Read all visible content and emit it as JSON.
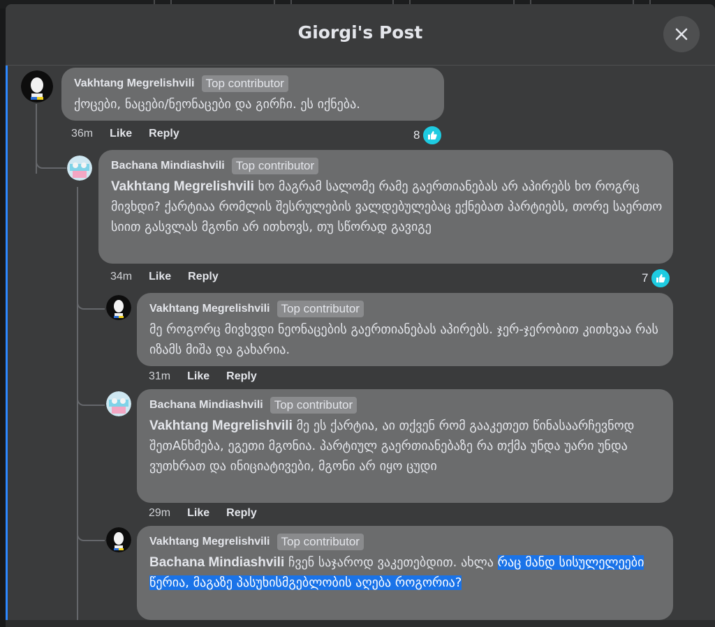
{
  "modal": {
    "title": "Giorgi's Post"
  },
  "badge_label": "Top contributor",
  "actions": {
    "like": "Like",
    "reply": "Reply"
  },
  "colors": {
    "accent": "#2d88ff",
    "like": "#1ecbe1",
    "highlight": "#1a73e8"
  },
  "comments": [
    {
      "author": "Vakhtang Megrelishvili",
      "text": "ქოცები, ნაცები/ნეონაცები და გირჩი. ეს იქნება.",
      "time": "36m",
      "reactions": "8"
    },
    {
      "author": "Bachana Mindiashvili",
      "mention": "Vakhtang Megrelishvili",
      "text": " ხო მაგრამ სალომე რამე გაერთიანებას არ აპირებს ხო როგრც მივხდი? ქარტიაა რომლის შესრულების ვალდებულებაც ექნებათ პარტიებს, თორე საერთო სიით გასვლას მგონი არ ითხოვს, თუ სწორად გავიგე",
      "time": "34m",
      "reactions": "7"
    },
    {
      "author": "Vakhtang Megrelishvili",
      "text": "მე როგორც მივხვდი ნეონაცების გაერთიანებას აპირებს. ჯერ-ჯერობით კითხვაა რას იზამს მიშა და გახარია.",
      "time": "31m"
    },
    {
      "author": "Bachana Mindiashvili",
      "mention": "Vakhtang Megrelishvili",
      "text": " მე ეს ქარტია, აი თქვენ რომ გააკეთეთ წინასაარჩევნოდ შეთAნხმება, ეგეთი მგონია. პარტიულ გაერთიანებაზე რა თქმა უნდა უარი უნდა ვუთხრათ და ინიციატივები, მგონი არ იყო ცუდი",
      "time": "29m"
    },
    {
      "author": "Vakhtang Megrelishvili",
      "mention": "Bachana Mindiashvili",
      "text": " ჩვენ საჯაროდ ვაკეთებდით. ახლა ",
      "highlighted": "რაც მანდ სისულელეები წერია, მაგაზე პასუხისმგებლობის აღება როგორია?"
    }
  ]
}
